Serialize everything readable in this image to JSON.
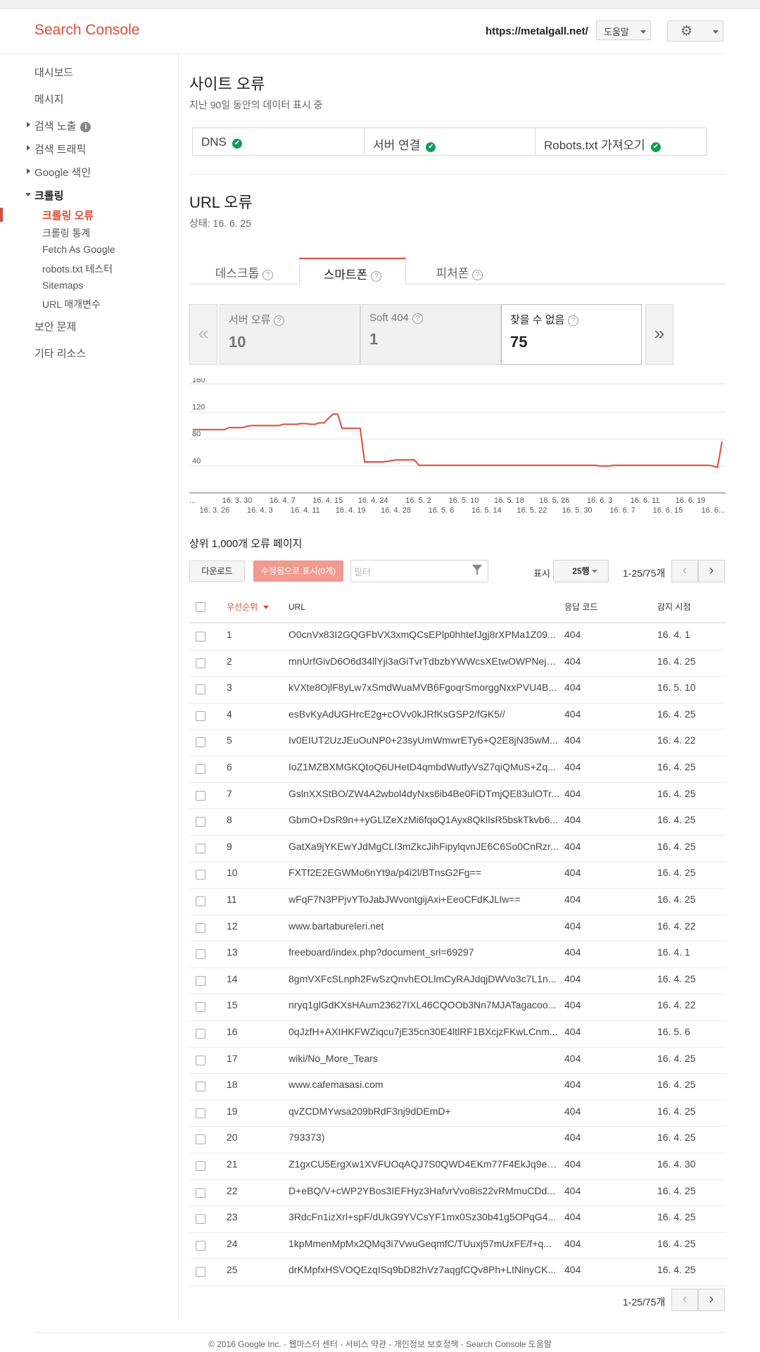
{
  "header": {
    "logo": "Search Console",
    "site_url": "https://metalgall.net/",
    "help_label": "도움말"
  },
  "sidebar": {
    "items": [
      "대시보드",
      "메시지",
      "검색 노출",
      "검색 트래픽",
      "Google 색인",
      "크롤링",
      "보안 문제",
      "기타 리소스"
    ],
    "crawl_sub": [
      "크롤링 오류",
      "크롤링 통계",
      "Fetch As Google",
      "robots.txt 테스터",
      "Sitemaps",
      "URL 매개변수"
    ],
    "active_sub": "크롤링 오류"
  },
  "site_errors": {
    "title": "사이트 오류",
    "subtitle": "지난 90일 동안의 데이터 표시 중",
    "cells": [
      {
        "label": "DNS",
        "status": "ok"
      },
      {
        "label": "서버 연결",
        "status": "ok"
      },
      {
        "label": "Robots.txt 가져오기",
        "status": "ok"
      }
    ],
    "check_color": "#0f9d58"
  },
  "url_errors": {
    "title": "URL 오류",
    "status": "상태: 16. 6. 25",
    "tabs": [
      "데스크톱",
      "스마트폰",
      "피처폰"
    ],
    "active_tab": "스마트폰",
    "metrics": [
      {
        "label": "서버 오류",
        "value": "10"
      },
      {
        "label": "Soft 404",
        "value": "1"
      },
      {
        "label": "찾을 수 없음",
        "value": "75"
      }
    ],
    "active_metric": "찾을 수 없음"
  },
  "chart_data": {
    "type": "line",
    "series": [
      {
        "values": [
          94,
          94,
          94,
          94,
          94,
          94,
          94,
          94,
          97,
          97,
          97,
          97,
          99,
          100,
          100,
          100,
          100,
          100,
          100,
          100,
          102,
          102,
          102,
          102,
          103,
          103,
          102,
          102,
          104,
          104,
          111,
          117,
          117,
          96,
          96,
          96,
          96,
          96,
          46,
          46,
          46,
          46,
          46,
          47,
          48,
          49,
          49,
          49,
          49,
          49,
          41,
          41,
          41,
          41,
          41,
          41,
          41,
          41,
          41,
          41,
          41,
          41,
          41,
          41,
          41,
          41,
          41,
          41,
          41,
          41,
          41,
          41,
          41,
          41,
          41,
          41,
          41,
          41,
          41,
          41,
          41,
          41,
          41,
          41,
          41,
          41,
          41,
          41,
          41,
          41,
          40,
          40,
          40,
          41,
          41,
          41,
          41,
          41,
          41,
          41,
          41,
          41,
          41,
          41,
          41,
          41,
          41,
          41,
          41,
          41,
          41,
          41,
          41,
          41,
          41,
          40,
          38,
          76
        ]
      }
    ],
    "ylim": [
      0,
      160
    ],
    "yticks": [
      40,
      80,
      120,
      160
    ],
    "xticks_top": [
      "16. 3. 30",
      "16. 4. 7",
      "16. 4. 15",
      "16. 4. 24",
      "16. 5. 2",
      "16. 5. 10",
      "16. 5. 18",
      "16. 5. 26",
      "16. 6. 3",
      "16. 6. 11",
      "16. 6. 19"
    ],
    "xticks_bottom": [
      "16. 3. 26",
      "16. 4. 3",
      "16. 4. 11",
      "16. 4. 19",
      "16. 4. 28",
      "16. 5. 6",
      "16. 5. 14",
      "16. 5. 22",
      "16. 5. 30",
      "16. 6. 7",
      "16. 6. 15",
      "16. 6..."
    ],
    "xtick_start": "...",
    "line_color": "#dd4b39",
    "grid": true
  },
  "error_pages": {
    "title": "상위 1,000개 오류 페이지",
    "download_label": "다운로드",
    "fixed_label": "수정됨으로 표시(0개)",
    "filter_placeholder": "필터",
    "show_label": "표시",
    "rows_select": "25행",
    "range_text": "1-25/75개",
    "columns": [
      "우선순위",
      "URL",
      "응답 코드",
      "감지 시점"
    ],
    "rows": [
      [
        "1",
        "O0cnVx83I2GQGFbVX3xmQCsEPlp0hhtefJgj8rXPMa1Z09...",
        "404",
        "16. 4. 1"
      ],
      [
        "2",
        "mnUrfGivD6O6d34llYji3aGiTvrTdbzbYWWcsXEtwOWPNejs...",
        "404",
        "16. 4. 25"
      ],
      [
        "3",
        "kVXte8OjlF8yLw7xSmdWuaMVB6FgoqrSmorggNxxPVU4B...",
        "404",
        "16. 5. 10"
      ],
      [
        "4",
        "esBvKyAdUGHrcE2g+cOVv0kJRfKsGSP2/fGK5//",
        "404",
        "16. 4. 25"
      ],
      [
        "5",
        "Iv0EIUT2UzJEuOuNP0+23syUmWmwrETy6+Q2E8jN35wM...",
        "404",
        "16. 4. 22"
      ],
      [
        "6",
        "IoZ1MZBXMGKQtoQ6UHetD4qmbdWutfyVsZ7qiQMuS+Zq...",
        "404",
        "16. 4. 25"
      ],
      [
        "7",
        "GslnXXStBO/ZW4A2wbol4dyNxs6ib4Be0FiDTmjQE83ulOTr...",
        "404",
        "16. 4. 25"
      ],
      [
        "8",
        "GbmO+DsR9n++yGLlZeXzMi6fqoQ1Ayx8QkIlsR5bskTkvb6...",
        "404",
        "16. 4. 25"
      ],
      [
        "9",
        "GatXa9jYKEwYJdMgCLI3mZkcJihFipylqvnJE6C6So0CnRzr...",
        "404",
        "16. 4. 25"
      ],
      [
        "10",
        "FXTf2E2EGWMo6nYt9a/p4i2l/BTnsG2Fg==",
        "404",
        "16. 4. 25"
      ],
      [
        "11",
        "wFqF7N3PPjvYToJabJWvontgijAxi+EeoCFdKJLlw==",
        "404",
        "16. 4. 25"
      ],
      [
        "12",
        "www.bartabureleri.net",
        "404",
        "16. 4. 22"
      ],
      [
        "13",
        "freeboard/index.php?document_srl=69297",
        "404",
        "16. 4. 1"
      ],
      [
        "14",
        "8gmVXFcSLnph2FwSzQnvhEOLlmCyRAJdqjDWVo3c7L1n...",
        "404",
        "16. 4. 25"
      ],
      [
        "15",
        "nryq1glGdKXsHAum23627IXL46CQOOb3Nn7MJATagacoo...",
        "404",
        "16. 4. 22"
      ],
      [
        "16",
        "0qJzfH+AXIHKFWZiqcu7jE35cn30E4ltlRF1BXcjzFKwLCnm...",
        "404",
        "16. 5. 6"
      ],
      [
        "17",
        "wiki/No_More_Tears",
        "404",
        "16. 4. 25"
      ],
      [
        "18",
        "www.cafemasasi.com",
        "404",
        "16. 4. 25"
      ],
      [
        "19",
        "qvZCDMYwsa209bRdF3nj9dDEmD+",
        "404",
        "16. 4. 25"
      ],
      [
        "20",
        "793373)",
        "404",
        "16. 4. 25"
      ],
      [
        "21",
        "Z1gxCU5ErgXw1XVFUOqAQJ7S0QWD4EKm77F4EkJq9e7...",
        "404",
        "16. 4. 30"
      ],
      [
        "22",
        "D+eBQ/V+cWP2YBos3IEFHyz3HafvrVvo8is22vRMmuCDd...",
        "404",
        "16. 4. 25"
      ],
      [
        "23",
        "3RdcFn1izXrl+spF/dUkG9YVCsYF1mx0Sz30b41g5OPqG4...",
        "404",
        "16. 4. 25"
      ],
      [
        "24",
        "1kpMmenMpMx2QMq3i7VwuGeqmfC/TUuxj57mUxFE/f+q...",
        "404",
        "16. 4. 25"
      ],
      [
        "25",
        "drKMpfxHSVOQEzqISq9bD82hVz7aqgfCQv8Ph+LtNinyCK...",
        "404",
        "16. 4. 25"
      ]
    ]
  },
  "footer": "© 2016 Google Inc. - 웹마스터 센터 - 서비스 약관 - 개인정보 보호정책 - Search Console 도움말",
  "colors": {
    "accent": "#dd4b39",
    "ok": "#0f9d58"
  }
}
